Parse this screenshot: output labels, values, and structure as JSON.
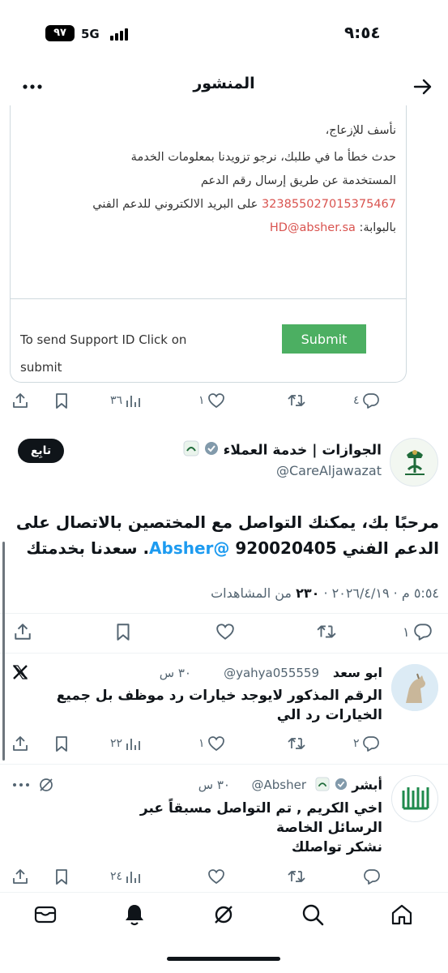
{
  "status": {
    "time": "٩:٥٤",
    "network": "5G",
    "battery": "٩٧"
  },
  "header": {
    "title": "المنشور"
  },
  "card": {
    "lines": [
      "نأسف للإزعاج،",
      "حدث خطأ ما في طلبك، نرجو تزويدنا بمعلومات الخدمة",
      "المستخدمة عن طريق إرسال رقم الدعم"
    ],
    "support_id": "323855027015375467",
    "line4_suffix": " على البريد الالكتروني للدعم الفني",
    "portal_label": "بالبوابة: ",
    "email": "HD@absher.sa",
    "footer_text": "To send Support ID Click on submit",
    "submit_label": "Submit"
  },
  "top_actions": {
    "replies": "٤",
    "retweets": "",
    "likes": "١",
    "views": "٣٦"
  },
  "main_tweet": {
    "author_name": "الجوازات | خدمة العملاء",
    "handle": "@CareAljawazat",
    "follow_label": "تابِع",
    "text_part1": "مرحبًا بك، يمكنك التواصل مع المختصين بالاتصال على الدعم الفني 920020405 ",
    "mention": "@Absher",
    "text_part2": ". سعدنا بخدمتك",
    "timestamp": "٥:٥٤ م · ٢٠٢٦/٤/١٩ · ",
    "views_count": "٢٣٠",
    "views_label": " من المشاهدات",
    "actions": {
      "replies": "١",
      "retweets": "",
      "likes": "",
      "bookmarks": ""
    }
  },
  "replies": [
    {
      "name": "ابو سعد",
      "handle": "@yahya055559",
      "time": "٣٠ س",
      "text": "الرقم المذكور لايوجد خيارات رد موظف بل جميع الخيارات رد الي",
      "actions": {
        "replies": "٢",
        "retweets": "",
        "likes": "١",
        "views": "٢٢"
      }
    },
    {
      "name": "أبشر",
      "handle": "@Absher",
      "time": "٣٠ س",
      "text_lines": [
        "اخي الكريم , تم التواصل مسبقاً عبر الرسائل الخاصة",
        "نشكر تواصلك"
      ],
      "actions": {
        "replies": "",
        "retweets": "",
        "likes": "",
        "views": "٢٤"
      }
    }
  ],
  "colors": {
    "accent": "#1d9bf0",
    "submit": "#4caf62",
    "red_text": "#d9534f",
    "verified": "#829aab"
  },
  "icons": [
    "back-arrow-icon",
    "more-icon",
    "share-icon",
    "bookmark-icon",
    "views-icon",
    "like-icon",
    "retweet-icon",
    "reply-icon",
    "x-logo-icon",
    "mute-icon",
    "mail-icon",
    "bell-icon",
    "grok-icon",
    "search-icon",
    "home-icon"
  ]
}
